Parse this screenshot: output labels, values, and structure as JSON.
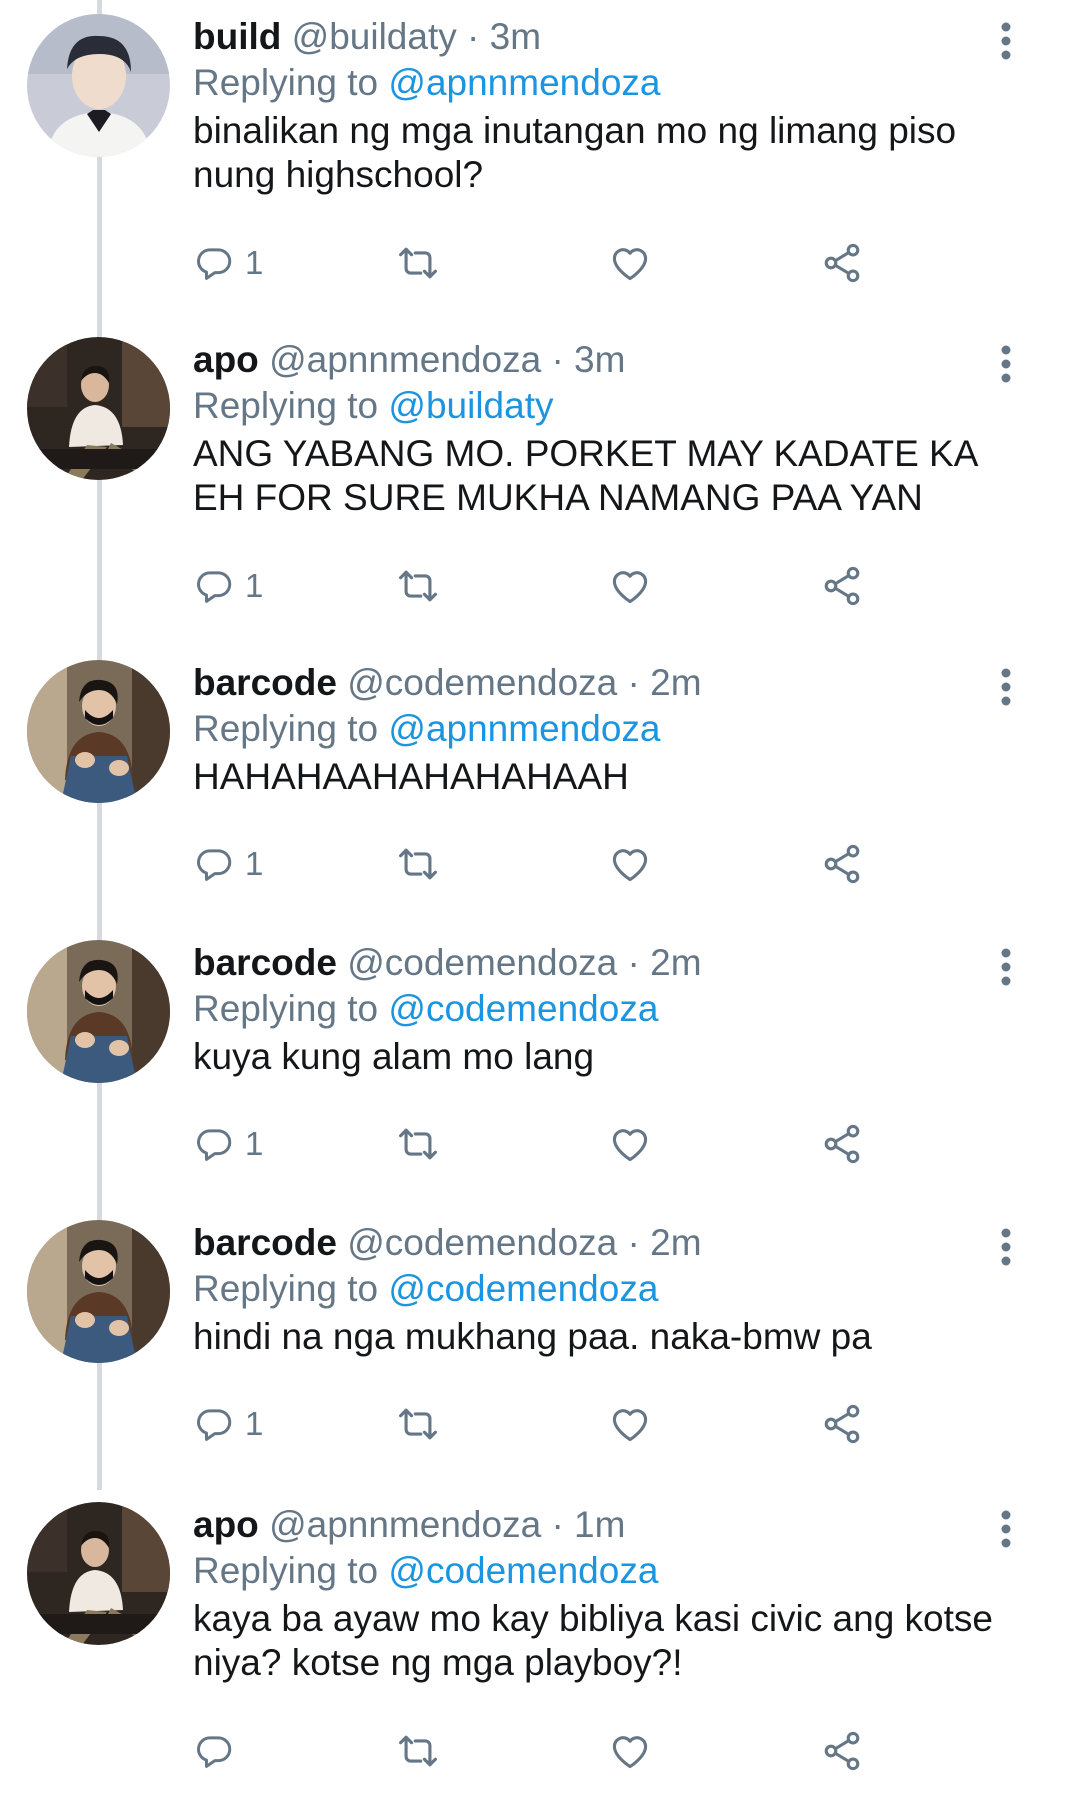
{
  "colors": {
    "name": "#14171a",
    "meta": "#657786",
    "mention": "#1b95e0",
    "thread_line": "#d6dade"
  },
  "tweets": [
    {
      "name": "build",
      "handle": "@buildaty",
      "time": "· 3m",
      "replying_prefix": "Replying to",
      "replying_to": "@apnnmendoza",
      "text": "binalikan ng mga inutangan mo ng limang piso nung highschool?",
      "reply_count": "1",
      "avatar": "build-avatar"
    },
    {
      "name": "apo",
      "handle": "@apnnmendoza",
      "time": "· 3m",
      "replying_prefix": "Replying to",
      "replying_to": "@buildaty",
      "text": "ANG YABANG MO. PORKET MAY KADATE KA EH FOR SURE MUKHA NAMANG PAA YAN",
      "reply_count": "1",
      "avatar": "apo-avatar"
    },
    {
      "name": "barcode",
      "handle": "@codemendoza",
      "time": "· 2m",
      "replying_prefix": "Replying to",
      "replying_to": "@apnnmendoza",
      "text": "HAHAHAAHAHAHAHAAH",
      "reply_count": "1",
      "avatar": "barcode-avatar"
    },
    {
      "name": "barcode",
      "handle": "@codemendoza",
      "time": "· 2m",
      "replying_prefix": "Replying to",
      "replying_to": "@codemendoza",
      "text": "kuya kung alam mo lang",
      "reply_count": "1",
      "avatar": "barcode-avatar"
    },
    {
      "name": "barcode",
      "handle": "@codemendoza",
      "time": "· 2m",
      "replying_prefix": "Replying to",
      "replying_to": "@codemendoza",
      "text": "hindi na nga mukhang paa. naka-bmw pa",
      "reply_count": "1",
      "avatar": "barcode-avatar"
    },
    {
      "name": "apo",
      "handle": "@apnnmendoza",
      "time": "· 1m",
      "replying_prefix": "Replying to",
      "replying_to": "@codemendoza",
      "text": "kaya ba ayaw mo kay bibliya kasi civic ang kotse niya? kotse ng mga playboy?!",
      "reply_count": "",
      "avatar": "apo-avatar"
    }
  ]
}
